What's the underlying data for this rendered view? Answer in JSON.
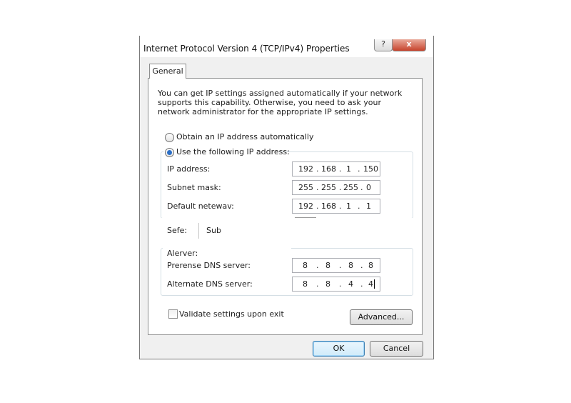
{
  "window": {
    "title": "Internet Protocol Version 4 (TCP/IPv4) Properties",
    "help_glyph": "?",
    "close_glyph": "x"
  },
  "tabs": [
    {
      "label": "General"
    }
  ],
  "general": {
    "intro_text": "You can get IP settings assigned automatically if your network supports this capability. Otherwise, you need to ask your network administrator for the appropriate IP settings.",
    "ip_auto_label": "Obtain an IP address automatically",
    "ip_manual_label": "Use the following IP address:",
    "ip_manual_selected": true,
    "fields": {
      "ip_address": {
        "label": "IP address:",
        "octets": [
          "192",
          "168",
          "1",
          "150"
        ]
      },
      "subnet_mask": {
        "label": "Subnet mask:",
        "octets": [
          "255",
          "255",
          "255",
          "0"
        ]
      },
      "default_gateway": {
        "label": "Default netewav:",
        "octets": [
          "192",
          "168",
          "1",
          "1"
        ]
      }
    },
    "glitch_text": {
      "sefe": "Sefe:",
      "sub": "Sub",
      "alerver": "Alerver:"
    },
    "dns": {
      "preferred": {
        "label": "Prerense DNS server:",
        "octets": [
          "8",
          "8",
          "8",
          "8"
        ]
      },
      "alternate": {
        "label": "Alternate DNS server:",
        "octets": [
          "8",
          "8",
          "4",
          "4"
        ]
      }
    },
    "validate_label": "Validate settings upon exit",
    "validate_checked": false,
    "advanced_label": "Advanced..."
  },
  "footer": {
    "ok_label": "OK",
    "cancel_label": "Cancel"
  },
  "colors": {
    "radio_dot": "#2b6fc7",
    "close_button": "#c7432c",
    "ok_border": "#3c7fb1"
  }
}
